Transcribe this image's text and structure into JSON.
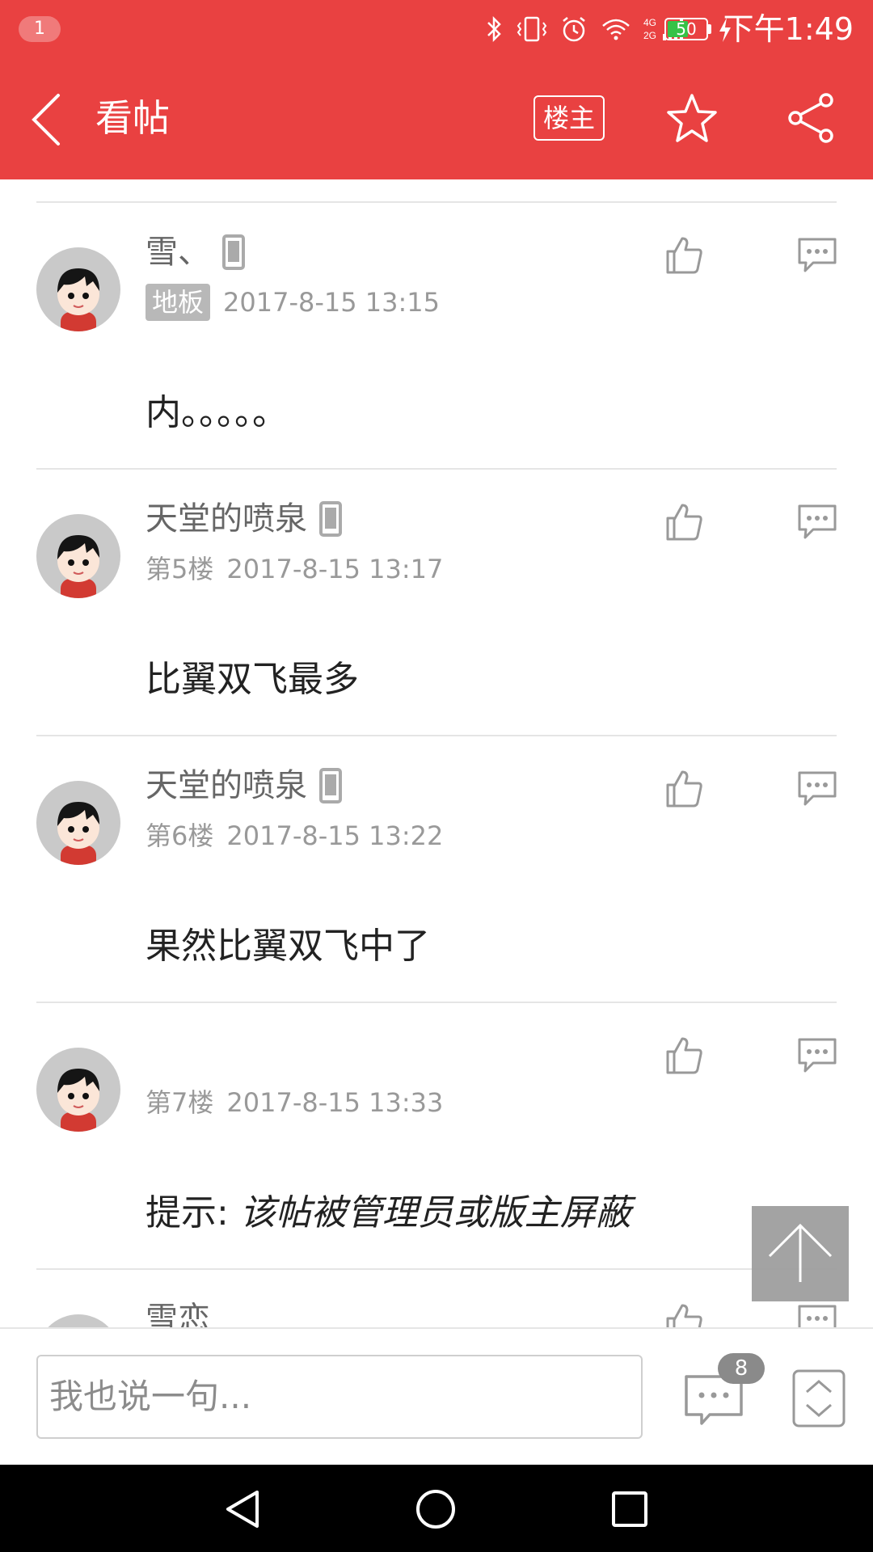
{
  "status_bar": {
    "notification_count": "1",
    "battery_level": "50",
    "time": "下午1:49"
  },
  "app_bar": {
    "title": "看帖",
    "owner_filter_label": "楼主"
  },
  "posts": [
    {
      "username": "雪、",
      "floor": "地板",
      "time": "2017-8-15 13:15",
      "content": "内。。。。。"
    },
    {
      "username": "天堂的喷泉",
      "floor": "第5楼",
      "time": "2017-8-15 13:17",
      "content": "比翼双飞最多"
    },
    {
      "username": "天堂的喷泉",
      "floor": "第6楼",
      "time": "2017-8-15 13:22",
      "content": "果然比翼双飞中了"
    },
    {
      "username": "",
      "floor": "第7楼",
      "time": "2017-8-15 13:33",
      "content_prefix": "提示: ",
      "content_italic": "该帖被管理员或版主屏蔽"
    },
    {
      "username": "雪恋"
    }
  ],
  "bottom_bar": {
    "reply_placeholder": "我也说一句...",
    "comment_count": "8"
  },
  "colors": {
    "brand_red": "#e94141",
    "badge_gray": "#b8b8b8",
    "count_gray": "#8a8a8a"
  },
  "icons": [
    "back-arrow-icon",
    "star-icon",
    "share-icon",
    "phone-icon",
    "thumbs-up-icon",
    "comment-icon",
    "arrow-up-icon",
    "chevron-updown-icon",
    "nav-back-icon",
    "nav-home-icon",
    "nav-recent-icon"
  ]
}
